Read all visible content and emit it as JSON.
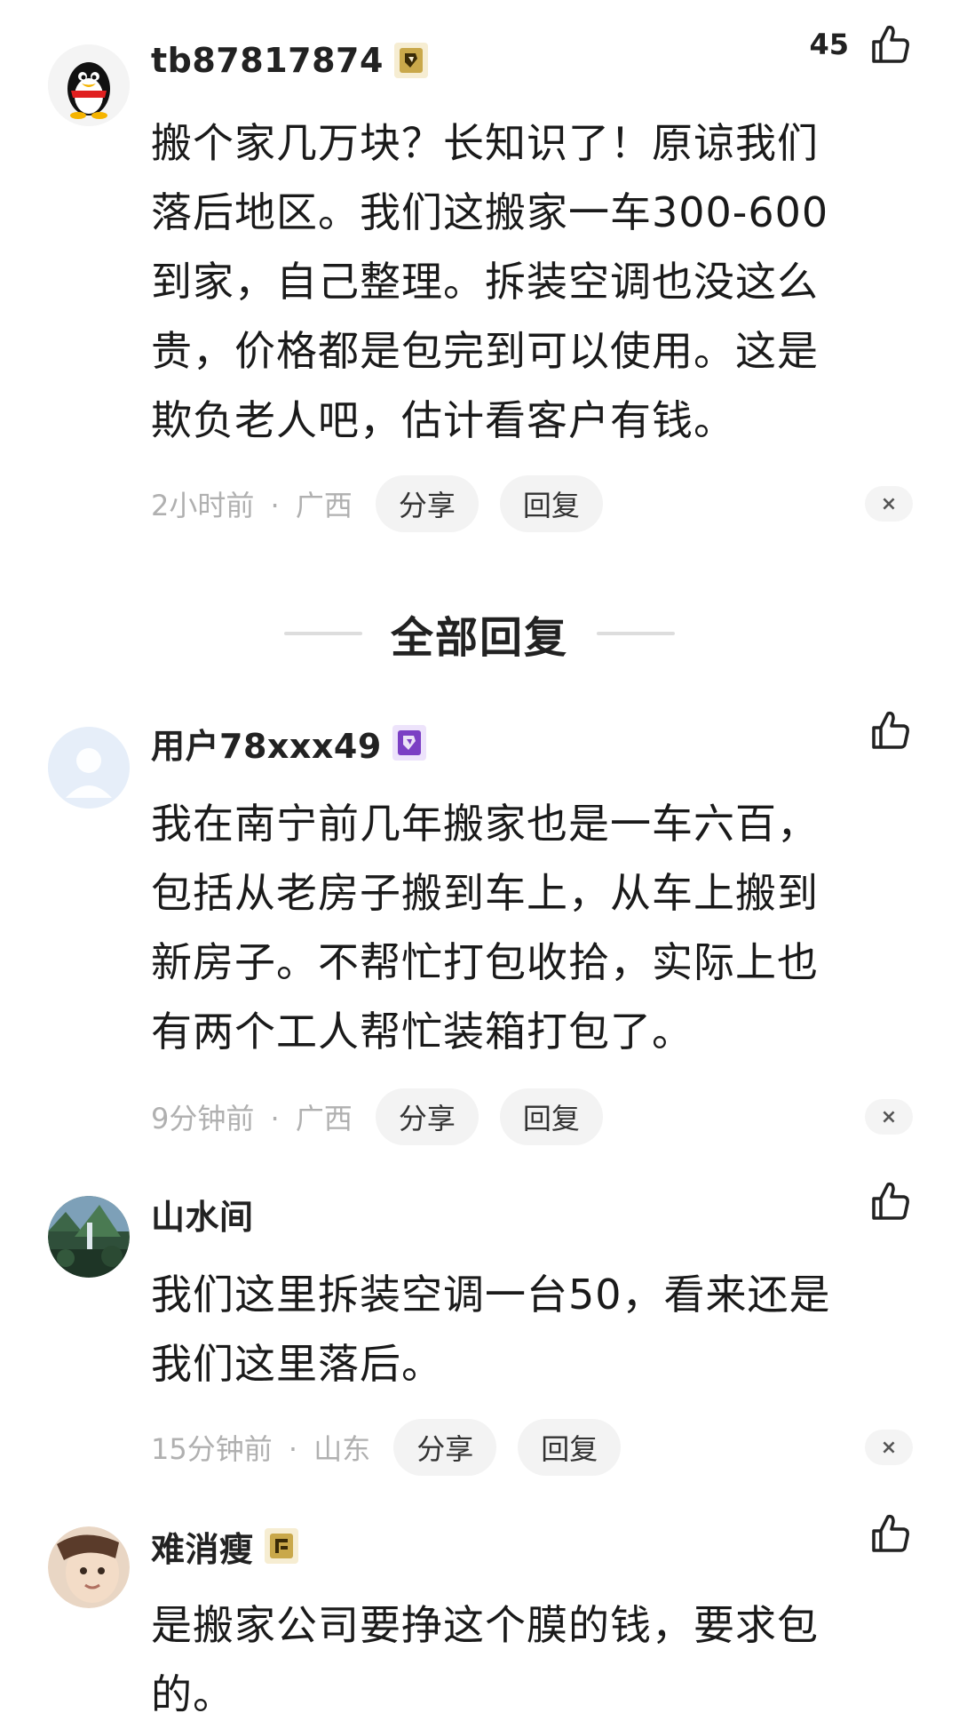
{
  "main_comment": {
    "username": "tb87817874",
    "like_count": "45",
    "lines": [
      "搬个家几万块？长知识了！原谅我们",
      "落后地区。我们这搬家一车300-600",
      "到家，自己整理。拆装空调也没这么",
      "贵，价格都是包完到可以使用。这是",
      "欺负老人吧，估计看客户有钱。"
    ],
    "time": "2小时前",
    "location": "广西",
    "share_label": "分享",
    "reply_label": "回复",
    "close_label": "×"
  },
  "section": {
    "title": "全部回复"
  },
  "replies": [
    {
      "username": "用户78xxx49",
      "lines": [
        "我在南宁前几年搬家也是一车六百，",
        "包括从老房子搬到车上，从车上搬到",
        "新房子。不帮忙打包收拾，实际上也",
        "有两个工人帮忙装箱打包了。"
      ],
      "time": "9分钟前",
      "location": "广西",
      "share_label": "分享",
      "reply_label": "回复",
      "close_label": "×"
    },
    {
      "username": "山水间",
      "lines": [
        "我们这里拆装空调一台50，看来还是",
        "我们这里落后。"
      ],
      "time": "15分钟前",
      "location": "山东",
      "share_label": "分享",
      "reply_label": "回复",
      "close_label": "×"
    },
    {
      "username": "难消瘦",
      "lines": [
        "是搬家公司要挣这个膜的钱，要求包",
        "的。"
      ]
    }
  ],
  "meta_separator": "·",
  "icons": {
    "like": "thumbs-up-icon",
    "badge_gold": "level-badge-icon",
    "badge_purple": "level-badge-icon"
  },
  "colors": {
    "meta_gray": "#b0b0b0",
    "pill_bg": "#f3f3f3",
    "badge_gold": "#c9a84a",
    "badge_purple": "#7b3fc4",
    "text": "#1a1a1a"
  }
}
